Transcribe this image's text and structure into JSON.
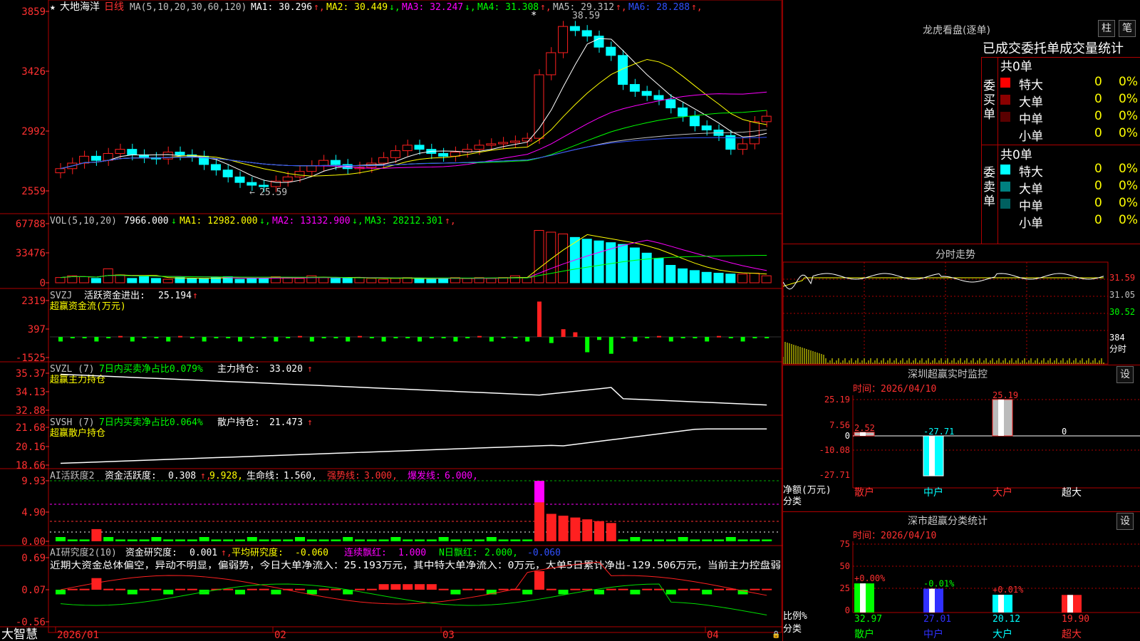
{
  "main": {
    "stock_name": "大地海洋",
    "period": "日线",
    "ma_params": "MA(5,10,20,30,60,120)",
    "ma": [
      {
        "label": "MA1:",
        "value": "30.296",
        "arrow": "↑",
        "color": "#ffffff"
      },
      {
        "label": "MA2:",
        "value": "30.449",
        "arrow": "↓",
        "color": "#ffff00"
      },
      {
        "label": "MA3:",
        "value": "32.247",
        "arrow": "↓",
        "color": "#ff00ff"
      },
      {
        "label": "MA4:",
        "value": "31.308",
        "arrow": "↑",
        "color": "#00ff00"
      },
      {
        "label": "MA5:",
        "value": "29.312",
        "arrow": "↑",
        "color": "#c0c0c0"
      },
      {
        "label": "MA6:",
        "value": "28.288",
        "arrow": "↑",
        "color": "#3050ff"
      }
    ],
    "price_axis": [
      "3859",
      "3426",
      "2992",
      "2559"
    ],
    "high_mark": "38.59",
    "low_mark": "25.59",
    "star_mark": "*"
  },
  "vol": {
    "params": "VOL(5,10,20)",
    "value": "7966.000",
    "ma": [
      {
        "label": "MA1:",
        "value": "12982.000",
        "arrow": "↓",
        "color": "#ffff00"
      },
      {
        "label": "MA2:",
        "value": "13132.900",
        "arrow": "↓",
        "color": "#ff00ff"
      },
      {
        "label": "MA3:",
        "value": "28212.301",
        "arrow": "↑",
        "color": "#00ff00"
      }
    ],
    "axis": [
      "67788",
      "33476",
      "0"
    ]
  },
  "svzj": {
    "title": "SVZJ",
    "text1": "活跃资金进出:",
    "value": "25.194",
    "arrow": "↑",
    "subtitle": "超赢资金流(万元)",
    "axis": [
      "2319",
      "397",
      "-1525"
    ]
  },
  "svzl": {
    "title": "SVZL (7)",
    "text1": "7日内买卖净占比0.079%",
    "text2": "主力持仓:",
    "value": "33.020",
    "arrow": "↑",
    "subtitle": "超赢主力持仓",
    "axis": [
      "35.37",
      "34.13",
      "32.88"
    ]
  },
  "svsh": {
    "title": "SVSH (7)",
    "text1": "7日内买卖净占比0.064%",
    "text2": "散户持仓:",
    "value": "21.473",
    "arrow": "↑",
    "subtitle": "超赢散户持仓",
    "axis": [
      "21.68",
      "20.16",
      "18.66"
    ]
  },
  "ai_active": {
    "title": "AI活跃度2",
    "text1": "资金活跃度:",
    "v1": "0.308",
    "v2": "9.928,",
    "life_label": "生命线:",
    "life": "1.560,",
    "strong_label": "强势线:",
    "strong": "3.000,",
    "burst_label": "爆发线:",
    "burst": "6.000,",
    "axis": [
      "9.93",
      "4.90",
      "0.00"
    ]
  },
  "ai_research": {
    "title": "AI研究度2(10)",
    "text1": "资金研究度:",
    "v1": "0.001",
    "avg_label": "平均研究度:",
    "avg": "-0.060",
    "lx_label": "连续飘红:",
    "lx": "1.000",
    "n_label": "N日飘红:",
    "n": "2.000,",
    "v_last": "-0.060",
    "summary": "近期大资金总体偏空，异动不明显，偏弱势，今日大单净流入：25.193万元，其中特大单净流入：0万元，大单5日累计净出-129.506万元，当前主力控盘弱",
    "axis": [
      "0.69",
      "0.07",
      "-0.56"
    ]
  },
  "date_axis": {
    "brand": "大智慧",
    "labels": [
      "2026/01",
      "02",
      "03",
      "04"
    ]
  },
  "lhb": {
    "title": "龙虎看盘(逐单)",
    "btn1": "柱",
    "btn2": "笔",
    "tabs": "已成交委托单成交量统计",
    "buy_label": "委买单",
    "sell_label": "委卖单",
    "buy_total": "共0单",
    "sell_total": "共0单",
    "rows_buy": [
      {
        "name": "特大",
        "v": "0",
        "p": "0%",
        "color": "#ff0000"
      },
      {
        "name": "大单",
        "v": "0",
        "p": "0%",
        "color": "#8b0000"
      },
      {
        "name": "中单",
        "v": "0",
        "p": "0%",
        "color": "#5a0000"
      },
      {
        "name": "小单",
        "v": "0",
        "p": "0%",
        "color": ""
      }
    ],
    "rows_sell": [
      {
        "name": "特大",
        "v": "0",
        "p": "0%",
        "color": "#00ffff"
      },
      {
        "name": "大单",
        "v": "0",
        "p": "0%",
        "color": "#008080"
      },
      {
        "name": "中单",
        "v": "0",
        "p": "0%",
        "color": "#006060"
      },
      {
        "name": "小单",
        "v": "0",
        "p": "0%",
        "color": ""
      }
    ]
  },
  "fenshi": {
    "title": "分时走势",
    "axis": [
      "31.59",
      "31.05",
      "30.52"
    ],
    "vol_axis": [
      "384",
      "分时"
    ]
  },
  "sz_monitor": {
    "title": "深圳超赢实时监控",
    "btn": "设",
    "time": "时间：2026/04/10",
    "axis": [
      "25.19",
      "7.56",
      "0",
      "-10.08",
      "-27.71"
    ],
    "ylabel": "净额(万元)",
    "xlabel": "分类",
    "bars": [
      {
        "name": "散户",
        "value": "2.52"
      },
      {
        "name": "中户",
        "value": "-27.71"
      },
      {
        "name": "大户",
        "value": "25.19"
      },
      {
        "name": "超大",
        "value": "0"
      }
    ]
  },
  "sz_stats": {
    "title": "深市超赢分类统计",
    "btn": "设",
    "time": "时间：2026/04/10",
    "axis": [
      "75",
      "50",
      "25",
      "0"
    ],
    "ylabel": "比例%",
    "xlabel": "分类",
    "bars": [
      {
        "name": "散户",
        "pct": "32.97",
        "chg": "+0.00%"
      },
      {
        "name": "中户",
        "pct": "27.01",
        "chg": "-0.01%"
      },
      {
        "name": "大户",
        "pct": "20.12",
        "chg": "+0.01%"
      },
      {
        "name": "超大",
        "pct": "19.90",
        "chg": ""
      }
    ]
  }
}
